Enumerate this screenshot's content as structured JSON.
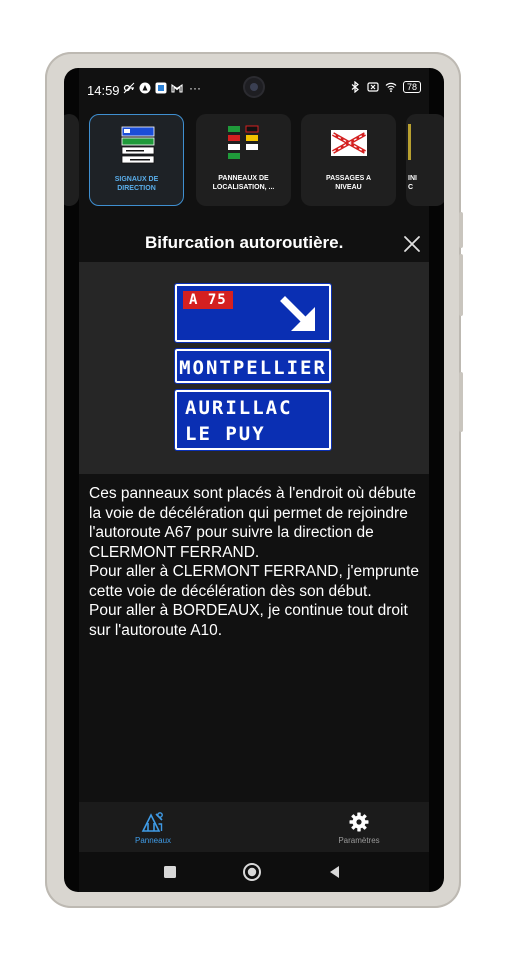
{
  "status_bar": {
    "time": "14:59",
    "left_icons": [
      "vpn-key-icon",
      "alert-circle-icon",
      "app-square-icon",
      "gmail-icon"
    ],
    "more": "···",
    "right_icons": [
      "bluetooth-icon",
      "no-sim-icon",
      "wifi-icon"
    ],
    "battery": "78"
  },
  "categories": [
    {
      "label": "",
      "icon": "partial-card"
    },
    {
      "label": "SIGNAUX DE\nDIRECTION",
      "icon": "direction-signs-thumb",
      "selected": true
    },
    {
      "label": "PANNEAUX DE\nLOCALISATION, ...",
      "icon": "localisation-signs-thumb"
    },
    {
      "label": "PASSAGES A\nNIVEAU",
      "icon": "level-crossing-thumb"
    },
    {
      "label": "INI\nC",
      "icon": "partial-thumb"
    }
  ],
  "dialog": {
    "title": "Bifurcation autoroutière.",
    "close_icon": "close-icon"
  },
  "sign": {
    "road_number": "A 75",
    "line_mid": "MONTPELLIER",
    "line_bot_1": "AURILLAC",
    "line_bot_2": "LE PUY",
    "colors": {
      "panel": "#0a2fb3",
      "road_badge": "#d42020",
      "text": "#ffffff"
    }
  },
  "description": "Ces panneaux sont placés à l'endroit où débute la voie de décélération qui permet de rejoindre l'autoroute A67 pour suivre la direction de CLERMONT FERRAND.\nPour aller à CLERMONT FERRAND, j'emprunte cette voie de décélération dès son début.\n Pour aller à BORDEAUX, je continue tout droit sur l'autoroute A10.",
  "bottom_nav": {
    "items": [
      {
        "label": "Panneaux",
        "icon": "road-signs-icon",
        "active": true
      },
      {
        "label": "Paramètres",
        "icon": "gear-icon",
        "active": false
      }
    ],
    "active_color": "#3f9be6",
    "inactive_color": "#9a9a9a"
  },
  "system_nav": [
    "recent-apps-icon",
    "home-icon",
    "back-icon"
  ]
}
